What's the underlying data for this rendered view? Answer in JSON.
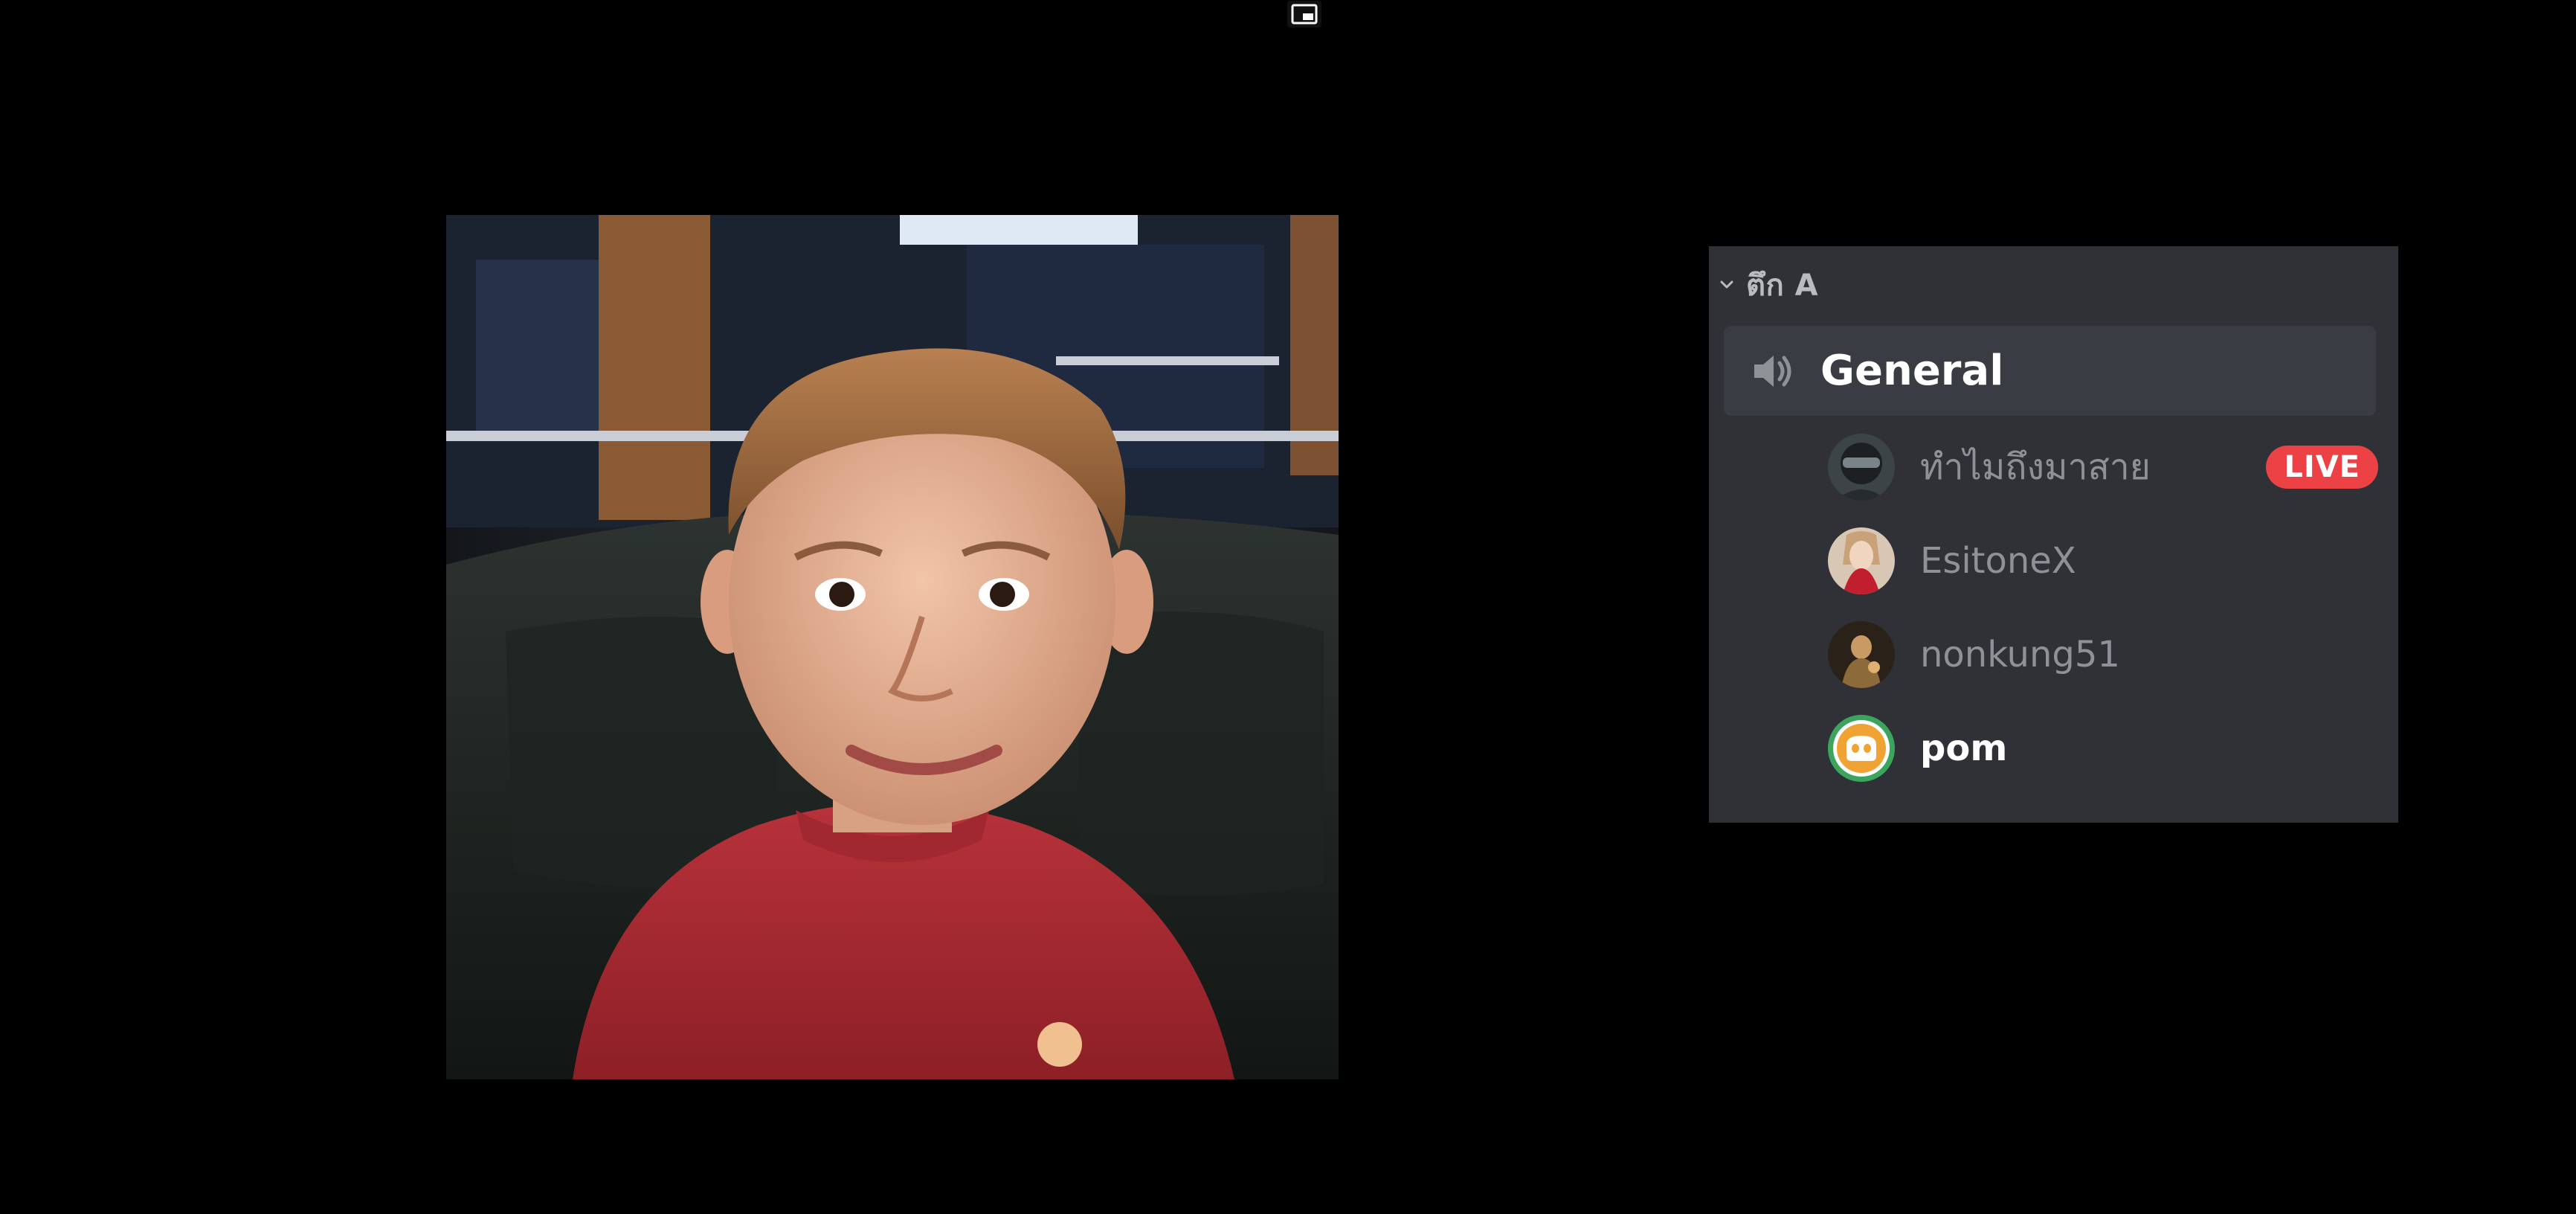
{
  "voice_overlay": {
    "category": {
      "label": "ตึก A",
      "icon": "chevron-down-icon"
    },
    "channel": {
      "name": "General",
      "icon": "speaker-icon"
    },
    "members": [
      {
        "name": "ทำไมถึงมาสาย",
        "badge": "LIVE",
        "speaking": false
      },
      {
        "name": "EsitoneX",
        "badge": null,
        "speaking": false
      },
      {
        "name": "nonkung51",
        "badge": null,
        "speaking": false
      },
      {
        "name": "pom",
        "badge": null,
        "speaking": true
      }
    ]
  },
  "colors": {
    "panel_bg": "#2f3136",
    "channel_highlight": "#393c43",
    "live_badge": "#ed4245",
    "speaking_ring": "#3ba55d",
    "muted_text": "#8e9297"
  }
}
